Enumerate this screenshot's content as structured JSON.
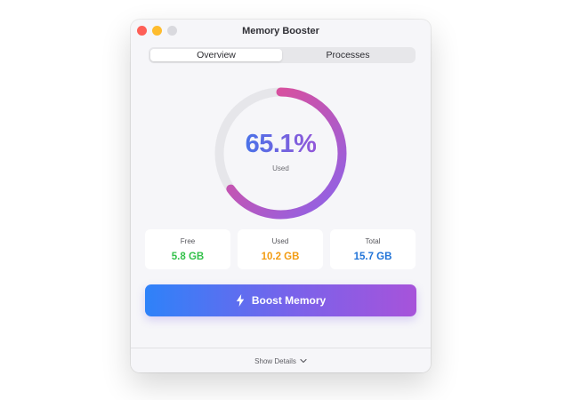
{
  "window": {
    "title": "Memory Booster"
  },
  "tabs": [
    {
      "label": "Overview",
      "active": true
    },
    {
      "label": "Processes",
      "active": false
    }
  ],
  "gauge": {
    "percent": 65.1,
    "percent_text": "65.1%",
    "label": "Used",
    "colors": {
      "start": "#8a63ec",
      "end": "#ef4a87",
      "track": "#e6e6ea"
    }
  },
  "stats": {
    "free": {
      "label": "Free",
      "value": "5.8 GB",
      "color": "#34c14b"
    },
    "used": {
      "label": "Used",
      "value": "10.2 GB",
      "color": "#f29c12"
    },
    "total": {
      "label": "Total",
      "value": "15.7 GB",
      "color": "#2174d8"
    }
  },
  "boost_button": {
    "label": "Boost Memory",
    "icon": "lightning-bolt-icon"
  },
  "footer": {
    "toggle_label": "Show Details",
    "icon": "chevron-down-icon"
  }
}
